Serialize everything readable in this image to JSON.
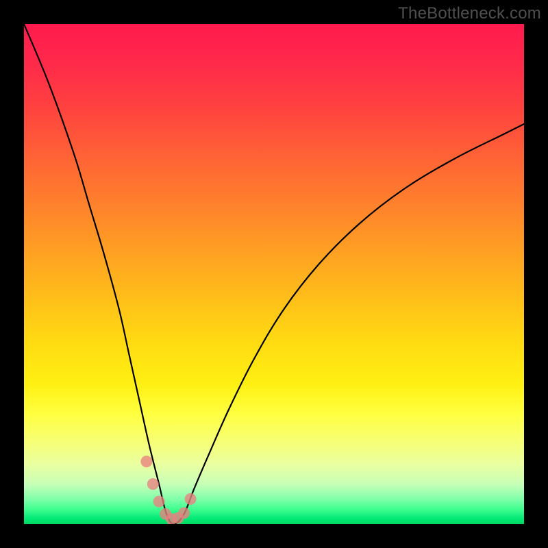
{
  "watermark": {
    "text": "TheBottleneck.com"
  },
  "chart_data": {
    "type": "line",
    "title": "",
    "xlabel": "",
    "ylabel": "",
    "ylim": [
      0,
      100
    ],
    "xlim": [
      0,
      100
    ],
    "series": [
      {
        "name": "bottleneck-curve",
        "x": [
          0,
          5,
          10,
          13,
          16,
          19,
          21,
          23,
          25,
          27,
          28.5,
          30,
          32,
          34,
          37,
          41,
          46,
          52,
          59,
          67,
          76,
          86,
          96,
          100
        ],
        "values": [
          100,
          88,
          74,
          64,
          54,
          43,
          34,
          25,
          16,
          8,
          2,
          0,
          2,
          7,
          14,
          23,
          33,
          43,
          52,
          60,
          67,
          73,
          78,
          80
        ]
      }
    ],
    "markers": {
      "name": "highlight-points",
      "x": [
        24.5,
        25.8,
        27.0,
        28.3,
        29.5,
        30.8,
        32.0,
        33.3
      ],
      "values": [
        12.5,
        8.0,
        4.5,
        2.0,
        1.0,
        1.2,
        2.2,
        5.0
      ]
    },
    "background_gradient_percent_to_color": {
      "0": "#ff1a4d",
      "50": "#ffb81e",
      "80": "#f8ff60",
      "100": "#00d860"
    }
  }
}
